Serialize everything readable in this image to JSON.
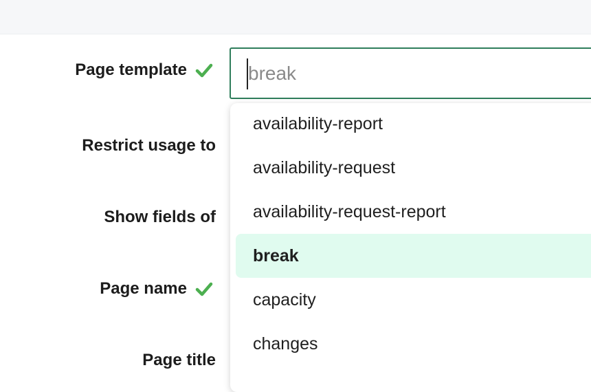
{
  "form": {
    "labels": {
      "page_template": "Page template",
      "restrict_usage_to": "Restrict usage to",
      "show_fields_of": "Show fields of",
      "page_name": "Page name",
      "page_title": "Page title"
    },
    "template_input": {
      "value": "",
      "placeholder": "break"
    }
  },
  "dropdown": {
    "items": [
      {
        "label": "availability-report",
        "selected": false
      },
      {
        "label": "availability-request",
        "selected": false
      },
      {
        "label": "availability-request-report",
        "selected": false
      },
      {
        "label": "break",
        "selected": true
      },
      {
        "label": "capacity",
        "selected": false
      },
      {
        "label": "changes",
        "selected": false
      }
    ]
  },
  "colors": {
    "check_green": "#4caf50",
    "input_border": "#2e7d5b",
    "selected_bg": "#e0fbef",
    "topbar_bg": "#f6f7f9"
  },
  "icons": {
    "valid": "checkmark-icon"
  }
}
